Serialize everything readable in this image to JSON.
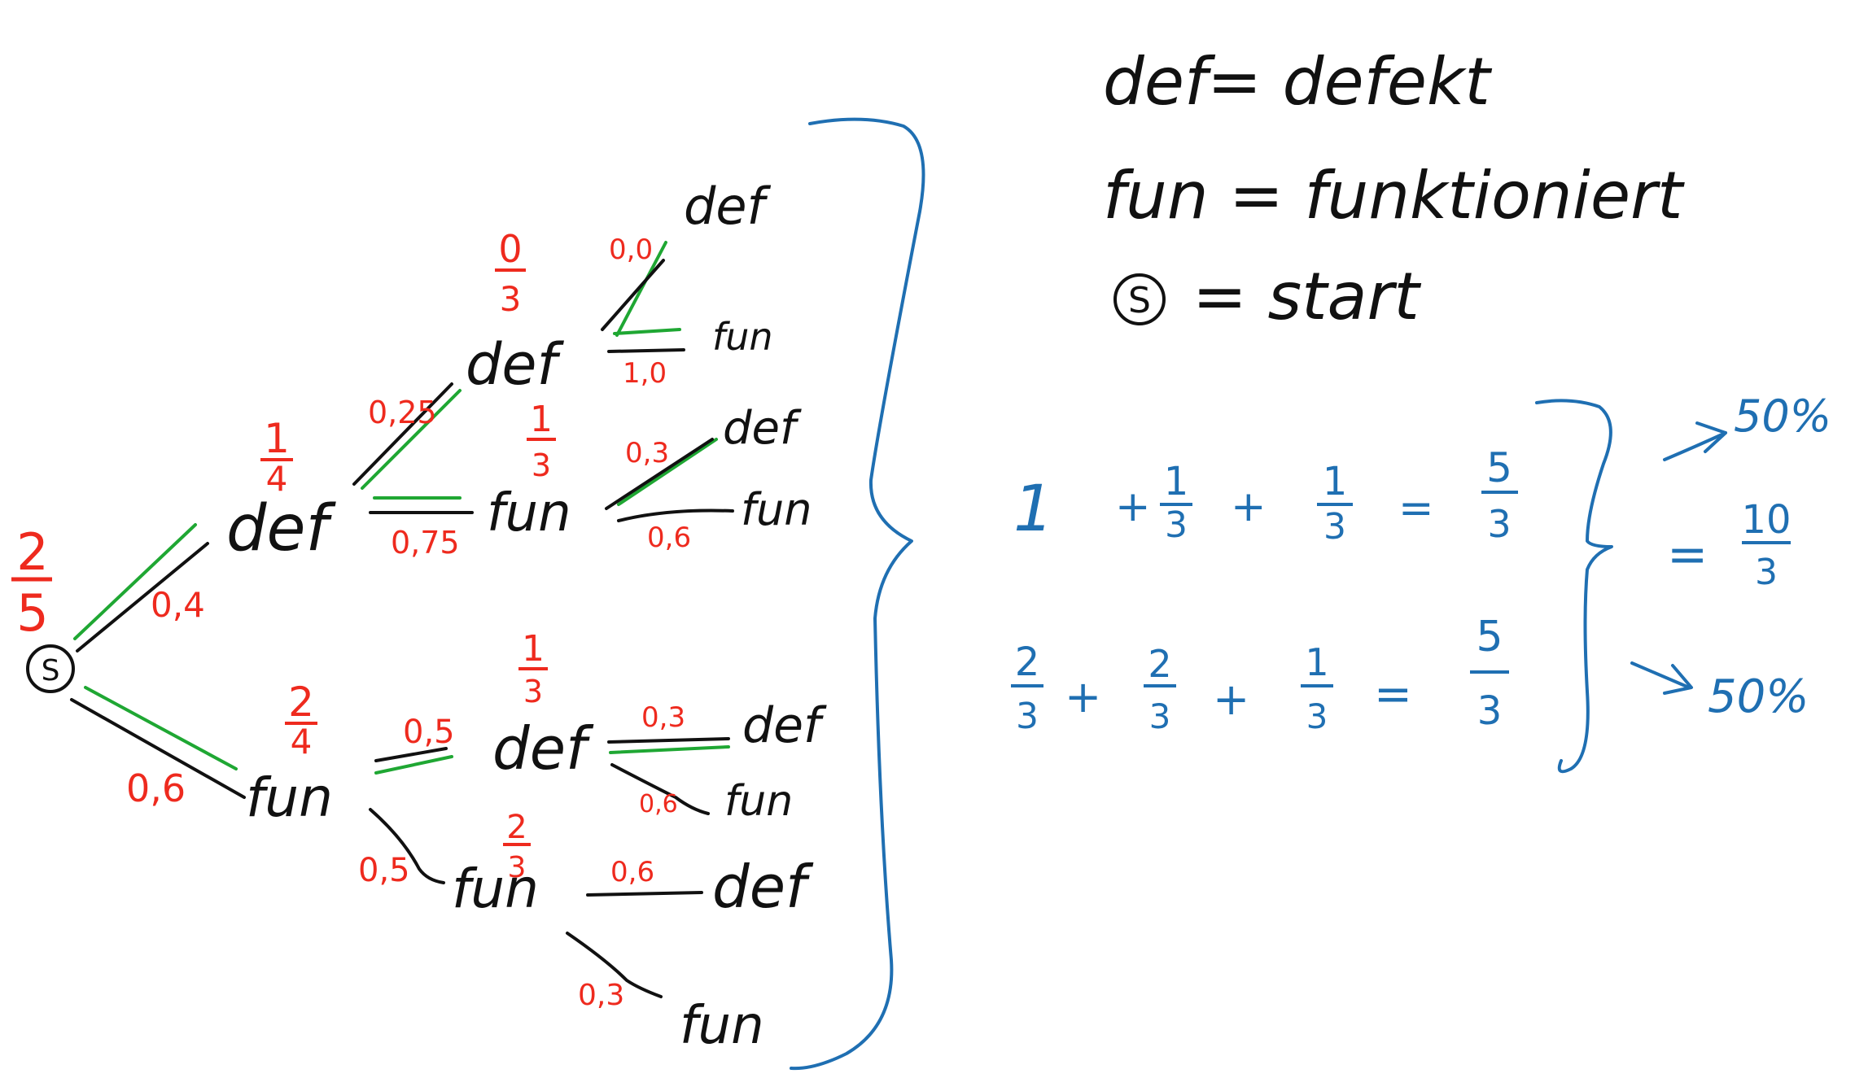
{
  "legend": {
    "def": "def= defekt",
    "fun": "fun = funktioniert",
    "start_symbol": "S",
    "start": "= start"
  },
  "tree": {
    "start": {
      "label": "S",
      "fraction": {
        "num": "2",
        "den": "5"
      }
    },
    "level1": [
      {
        "label": "def",
        "prob": "0,4",
        "fraction": {
          "num": "1",
          "den": "4"
        }
      },
      {
        "label": "fun",
        "prob": "0,6",
        "fraction": {
          "num": "2",
          "den": "4"
        }
      }
    ],
    "level2": [
      {
        "label": "def",
        "prob": "0,25",
        "fraction": {
          "num": "0",
          "den": "3"
        }
      },
      {
        "label": "fun",
        "prob": "0,75",
        "fraction": {
          "num": "1",
          "den": "3"
        }
      },
      {
        "label": "def",
        "prob": "0,5",
        "fraction": {
          "num": "1",
          "den": "3"
        }
      },
      {
        "label": "fun",
        "prob": "0,5",
        "fraction": {
          "num": "2",
          "den": "3"
        }
      }
    ],
    "level3": [
      {
        "label": "def",
        "prob": "0,0"
      },
      {
        "label": "fun",
        "prob": "1,0"
      },
      {
        "label": "def",
        "prob": "0,3"
      },
      {
        "label": "fun",
        "prob": "0,6"
      },
      {
        "label": "def",
        "prob": "0,3"
      },
      {
        "label": "fun",
        "prob": "0,6"
      },
      {
        "label": "def",
        "prob": "0,6"
      },
      {
        "label": "fun",
        "prob": "0,3"
      }
    ]
  },
  "sums": {
    "row1": {
      "a": "1",
      "b": {
        "num": "1",
        "den": "3"
      },
      "c": {
        "num": "1",
        "den": "3"
      },
      "result": {
        "num": "5",
        "den": "3"
      }
    },
    "row2": {
      "a": {
        "num": "2",
        "den": "3"
      },
      "b": {
        "num": "2",
        "den": "3"
      },
      "c": {
        "num": "1",
        "den": "3"
      },
      "result": {
        "num": "5",
        "den": "3"
      }
    },
    "total": {
      "num": "10",
      "den": "3"
    },
    "pct_top": "50%",
    "pct_bottom": "50%"
  },
  "colors": {
    "black": "#111111",
    "red": "#ee2a1e",
    "green": "#1fa733",
    "blue": "#1f6fb2"
  }
}
